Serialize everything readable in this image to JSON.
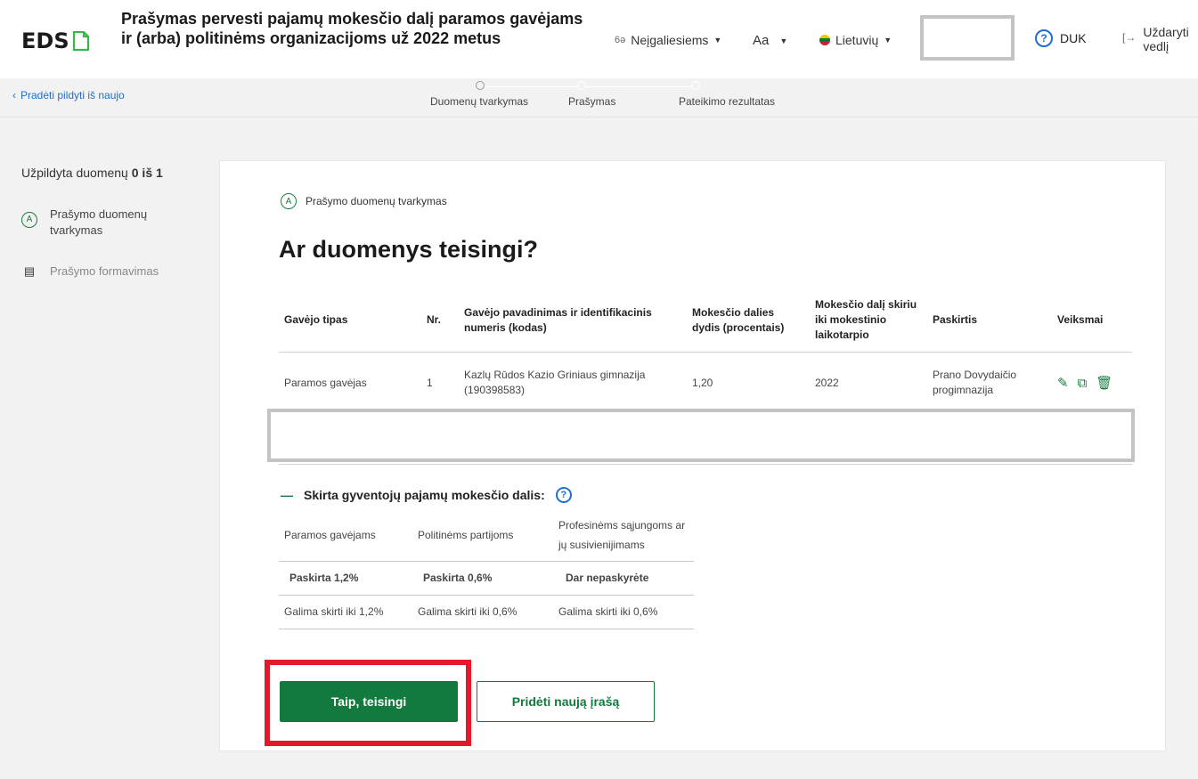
{
  "header": {
    "logo": "EDS",
    "title": "Prašymas pervesti pajamų mokesčio dalį paramos gavėjams ir (arba) politinėms organizacijoms už 2022 metus",
    "accessibility_label": "Neįgaliesiems",
    "font_label": "Aa",
    "language_label": "Lietuvių",
    "faq_label": "DUK",
    "close_label_line1": "Uždaryti",
    "close_label_line2": "vedlį"
  },
  "stepbar": {
    "restart_label": "Pradėti pildyti iš naujo",
    "steps": [
      "Duomenų tvarkymas",
      "Prašymas",
      "Pateikimo rezultatas"
    ]
  },
  "sidebar": {
    "progress_text": "Užpildyta duomenų",
    "progress_value": "0 iš 1",
    "items": [
      {
        "badge": "A",
        "label": "Prašymo duomenų tvarkymas"
      },
      {
        "label": "Prašymo formavimas"
      }
    ]
  },
  "main": {
    "sub_step_badge": "A",
    "sub_step_label": "Prašymo duomenų tvarkymas",
    "heading": "Ar duomenys teisingi?",
    "table": {
      "headers": [
        "Gavėjo tipas",
        "Nr.",
        "Gavėjo pavadinimas ir identifikacinis numeris (kodas)",
        "Mokesčio dalies dydis (procentais)",
        "Mokesčio dalį skiriu iki mokestinio laikotarpio",
        "Paskirtis",
        "Veiksmai"
      ],
      "rows": [
        {
          "type": "Paramos gavėjas",
          "nr": "1",
          "name": "Kazlų Rūdos Kazio Griniaus gimnazija (190398583)",
          "percent": "1,20",
          "period": "2022",
          "purpose": "Prano Dovydaičio progimnazija"
        }
      ]
    },
    "allocation": {
      "title": "Skirta gyventojų pajamų mokesčio dalis:",
      "col1": "Paramos gavėjams",
      "col2": "Politinėms partijoms",
      "col3": "Profesinėms sąjungoms ar jų susivienijimams",
      "assigned1": "Paskirta 1,2%",
      "assigned2": "Paskirta 0,6%",
      "assigned3": "Dar nepaskyrėte",
      "limit1": "Galima skirti iki 1,2%",
      "limit2": "Galima skirti iki 0,6%",
      "limit3": "Galima skirti iki 0,6%"
    },
    "btn_confirm": "Taip, teisingi",
    "btn_add": "Pridėti naują įrašą"
  },
  "colors": {
    "brand_green": "#137a3e",
    "link_blue": "#1f6fd0",
    "alert_red": "#e0283a",
    "highlight_frame": "#e3192a"
  }
}
